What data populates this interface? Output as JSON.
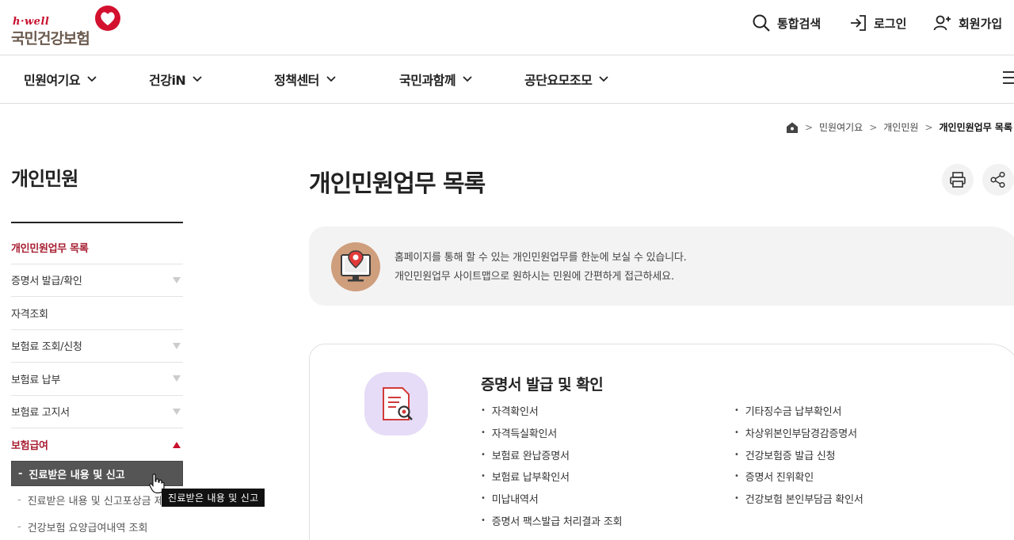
{
  "header": {
    "logo_sub": "h·well",
    "logo_main": "국민건강보험",
    "utils": [
      "통합검색",
      "로그인",
      "회원가입"
    ]
  },
  "gnb": {
    "items": [
      "민원여기요",
      "건강iN",
      "정책센터",
      "국민과함께",
      "공단요모조모"
    ]
  },
  "breadcrumb": [
    "민원여기요",
    "개인민원",
    "개인민원업무 목록"
  ],
  "lnb": {
    "title": "개인민원",
    "items": [
      {
        "label": "개인민원업무 목록"
      },
      {
        "label": "증명서 발급/확인"
      },
      {
        "label": "자격조회"
      },
      {
        "label": "보험료 조회/신청"
      },
      {
        "label": "보험료 납부"
      },
      {
        "label": "보험료 고지서"
      },
      {
        "label": "보험급여"
      }
    ],
    "sub_items": [
      "진료받은 내용 및 신고",
      "진료받은 내용 및 신고포상금 제",
      "건강보험 요양급여내역 조회"
    ],
    "tooltip": "진료받은 내용 및 신고"
  },
  "main": {
    "title": "개인민원업무 목록",
    "intro_lines": [
      "홈페이지를 통해 할 수 있는 개인민원업무를 한눈에 보실 수 있습니다.",
      "개인민원업무 사이트맵으로 원하시는 민원에 간편하게 접근하세요."
    ],
    "card": {
      "title": "증명서 발급 및 확인",
      "left": [
        "자격확인서",
        "자격득실확인서",
        "보험료 완납증명서",
        "보험료 납부확인서",
        "미납내역서",
        "증명서 팩스발급 처리결과 조회"
      ],
      "right": [
        "기타징수금 납부확인서",
        "차상위본인부담경감증명서",
        "건강보험증 발급 신청",
        "증명서 진위확인",
        "건강보험 본인부담금 확인서"
      ]
    }
  },
  "colors": {
    "brand": "#c8102e",
    "active": "#a71d31",
    "intro_icon_bg": "#cf9e7c",
    "card_icon_bg": "#e6dcf7"
  },
  "icons": [
    "search-icon",
    "login-icon",
    "user-plus-icon",
    "chevron-down-icon",
    "menu-icon",
    "home-icon",
    "print-icon",
    "share-icon",
    "monitor-location-icon",
    "document-search-icon"
  ]
}
